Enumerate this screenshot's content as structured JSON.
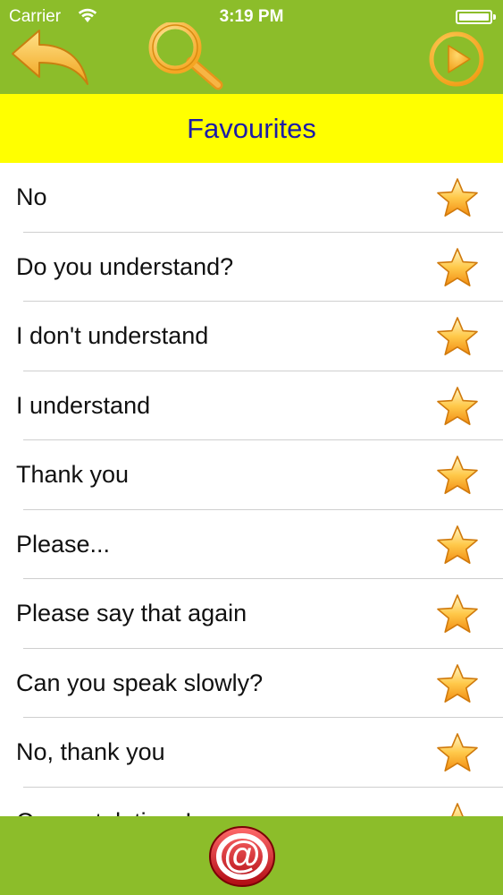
{
  "status_bar": {
    "carrier": "Carrier",
    "time": "3:19 PM"
  },
  "toolbar": {
    "back_icon": "back-arrow-icon",
    "search_icon": "magnifier-icon",
    "play_icon": "play-icon"
  },
  "header": {
    "title": "Favourites"
  },
  "favourites": [
    {
      "label": "No"
    },
    {
      "label": "Do you understand?"
    },
    {
      "label": "I don't understand"
    },
    {
      "label": "I understand"
    },
    {
      "label": "Thank you"
    },
    {
      "label": "Please..."
    },
    {
      "label": "Please say that again"
    },
    {
      "label": "Can you speak slowly?"
    },
    {
      "label": "No, thank you"
    },
    {
      "label": "Congratulations!"
    }
  ],
  "footer": {
    "email_icon": "at-sign-icon"
  },
  "colors": {
    "bar_green": "#8cbd2a",
    "title_yellow": "#ffff00",
    "title_text": "#1c1ca8",
    "icon_orange": "#f5a623",
    "email_red": "#d0141c"
  }
}
